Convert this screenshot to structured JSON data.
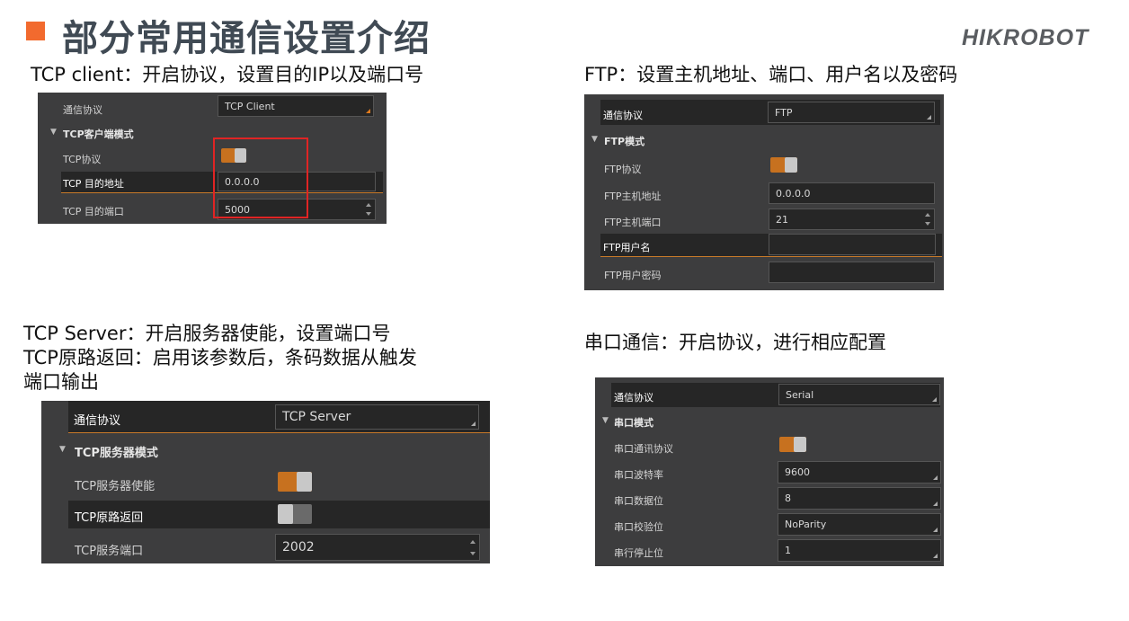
{
  "header": {
    "title": "部分常用通信设置介绍",
    "logo_text": "HIKROBOT"
  },
  "colors": {
    "accent": "#f26a2e",
    "panel_bg": "#3d3d3e",
    "toggle_on": "#c7711f",
    "highlight_box": "#e02424"
  },
  "captions": {
    "tcp_client": "TCP client：开启协议，设置目的IP以及端口号",
    "ftp": "FTP：设置主机地址、端口、用户名以及密码",
    "tcp_server_1": "TCP Server：开启服务器使能，设置端口号",
    "tcp_server_2": "TCP原路返回：启用该参数后，条码数据从触发",
    "tcp_server_3": "端口输出",
    "serial": "串口通信：开启协议，进行相应配置"
  },
  "tcp_client_panel": {
    "protocol_label": "通信协议",
    "protocol_value": "TCP Client",
    "section_title": "TCP客户端模式",
    "protocol_toggle_label": "TCP协议",
    "protocol_toggle_on": true,
    "dest_addr_label": "TCP 目的地址",
    "dest_addr_value": "0.0.0.0",
    "dest_port_label": "TCP 目的端口",
    "dest_port_value": "5000"
  },
  "ftp_panel": {
    "protocol_label": "通信协议",
    "protocol_value": "FTP",
    "section_title": "FTP模式",
    "protocol_toggle_label": "FTP协议",
    "protocol_toggle_on": true,
    "host_addr_label": "FTP主机地址",
    "host_addr_value": "0.0.0.0",
    "host_port_label": "FTP主机端口",
    "host_port_value": "21",
    "username_label": "FTP用户名",
    "username_value": "",
    "password_label": "FTP用户密码",
    "password_value": ""
  },
  "tcp_server_panel": {
    "protocol_label": "通信协议",
    "protocol_value": "TCP Server",
    "section_title": "TCP服务器模式",
    "enable_label": "TCP服务器使能",
    "enable_on": true,
    "loopback_label": "TCP原路返回",
    "loopback_on": false,
    "port_label": "TCP服务端口",
    "port_value": "2002"
  },
  "serial_panel": {
    "protocol_label": "通信协议",
    "protocol_value": "Serial",
    "section_title": "串口模式",
    "protocol_toggle_label": "串口通讯协议",
    "protocol_toggle_on": true,
    "baud_label": "串口波特率",
    "baud_value": "9600",
    "databits_label": "串口数据位",
    "databits_value": "8",
    "parity_label": "串口校验位",
    "parity_value": "NoParity",
    "stopbits_label": "串行停止位",
    "stopbits_value": "1"
  }
}
